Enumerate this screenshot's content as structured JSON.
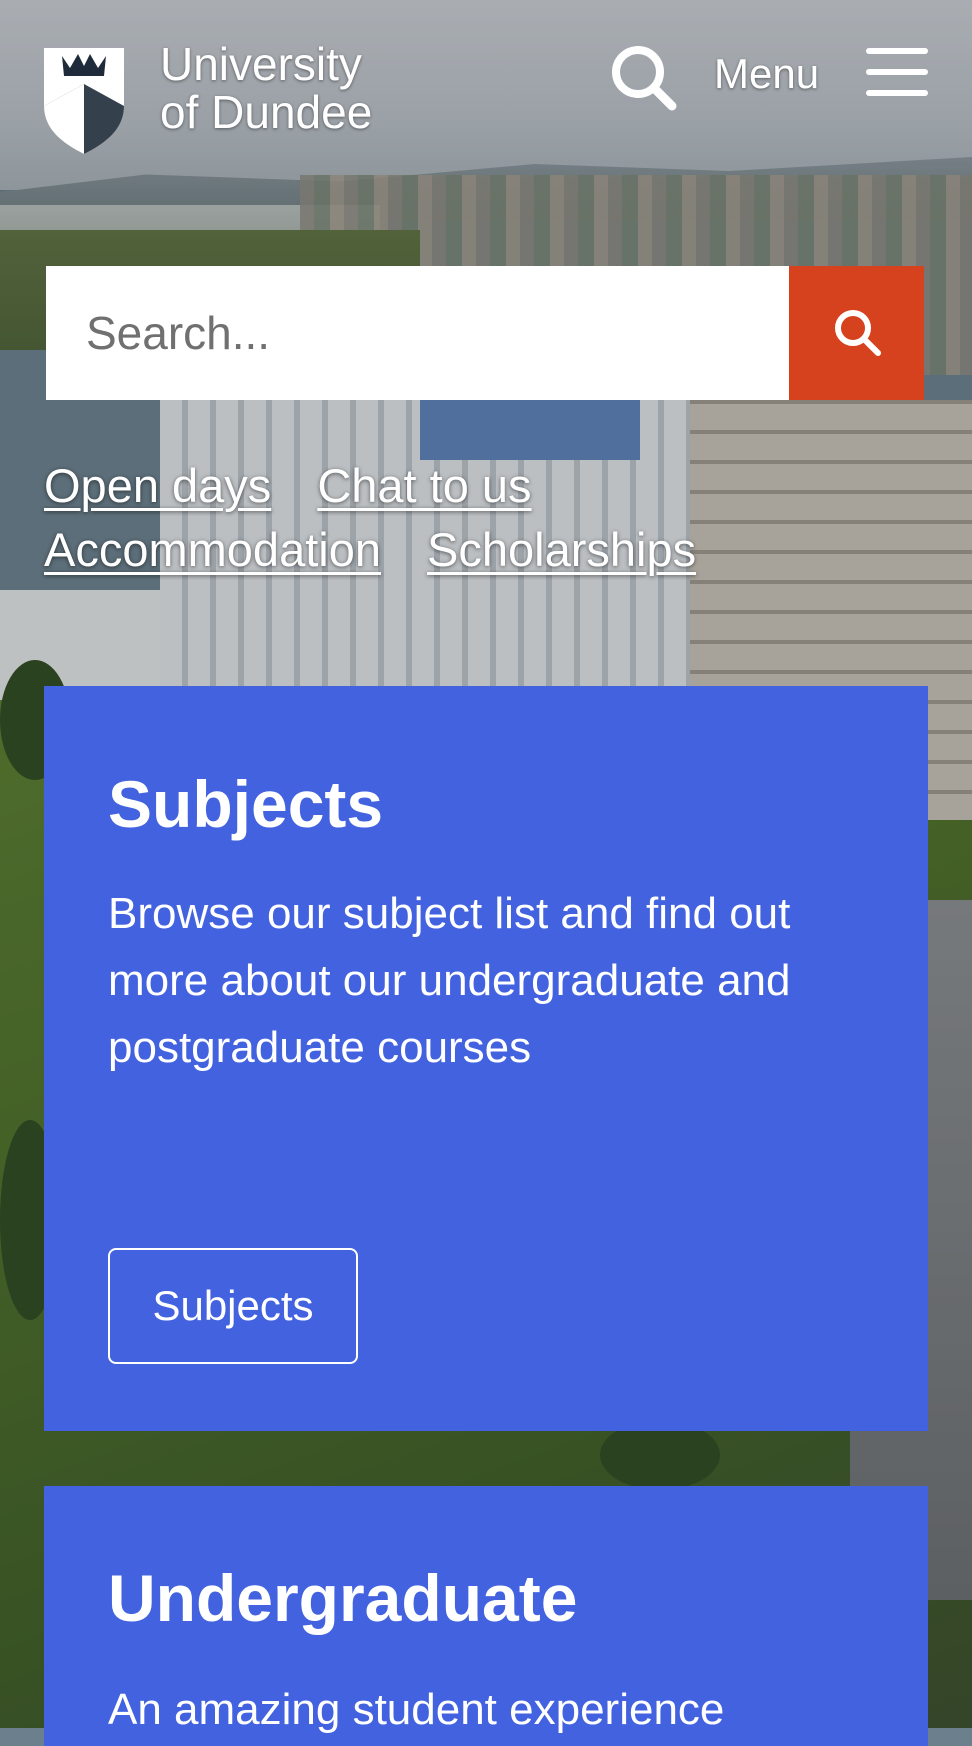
{
  "header": {
    "logo_line1": "University",
    "logo_line2": "of Dundee",
    "search_icon": "search-icon",
    "menu_label": "Menu",
    "menu_icon": "hamburger-icon"
  },
  "search": {
    "placeholder": "Search...",
    "button_icon": "search-icon",
    "button_color": "#d6421e"
  },
  "quick_links": [
    {
      "label": "Open days"
    },
    {
      "label": "Chat to us"
    },
    {
      "label": "Accommodation"
    },
    {
      "label": "Scholarships"
    }
  ],
  "cards": [
    {
      "title": "Subjects",
      "text": "Browse our subject list and find out more about our undergraduate and postgraduate courses",
      "button_label": "Subjects"
    },
    {
      "title": "Undergraduate",
      "text": "An amazing student experience"
    }
  ],
  "colors": {
    "card_blue": "#4262e0",
    "search_orange": "#d6421e",
    "text": "#ffffff"
  }
}
